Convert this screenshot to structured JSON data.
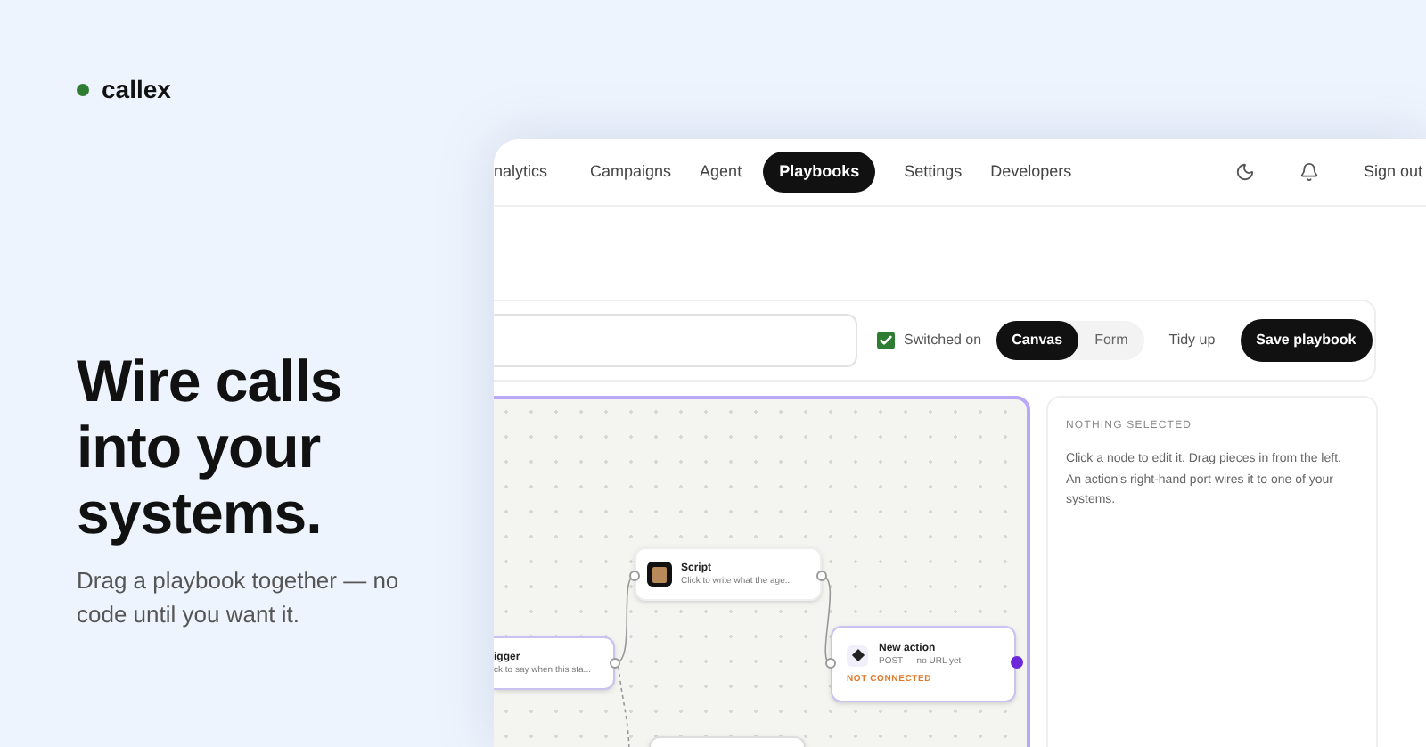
{
  "brand": {
    "name": "callex"
  },
  "hero": {
    "headline": "Wire calls into your systems.",
    "subhead": "Drag a playbook together — no code until you want it."
  },
  "nav": {
    "items": [
      {
        "label": "nalytics",
        "selected": false
      },
      {
        "label": "Campaigns",
        "selected": false
      },
      {
        "label": "Agent",
        "selected": false
      },
      {
        "label": "Playbooks",
        "selected": true
      },
      {
        "label": "Settings",
        "selected": false
      },
      {
        "label": "Developers",
        "selected": false
      }
    ],
    "sign_out": "Sign out"
  },
  "toolbar": {
    "switched_on": {
      "label": "Switched on",
      "checked": true
    },
    "view_modes": [
      {
        "label": "Canvas",
        "selected": true
      },
      {
        "label": "Form",
        "selected": false
      }
    ],
    "tidy_up": "Tidy up",
    "save": "Save playbook"
  },
  "canvas": {
    "nodes": [
      {
        "kind": "trigger",
        "title": "igger",
        "subtitle": "ck to say when this sta..."
      },
      {
        "kind": "script",
        "title": "Script",
        "subtitle": "Click to write what the age..."
      },
      {
        "kind": "action",
        "title": "New action",
        "subtitle": "POST — no URL yet",
        "status": "NOT CONNECTED"
      },
      {
        "kind": "empty"
      }
    ]
  },
  "inspector": {
    "heading": "NOTHING SELECTED",
    "body": "Click a node to edit it. Drag pieces in from the left. An action's right-hand port wires it to one of your systems."
  }
}
